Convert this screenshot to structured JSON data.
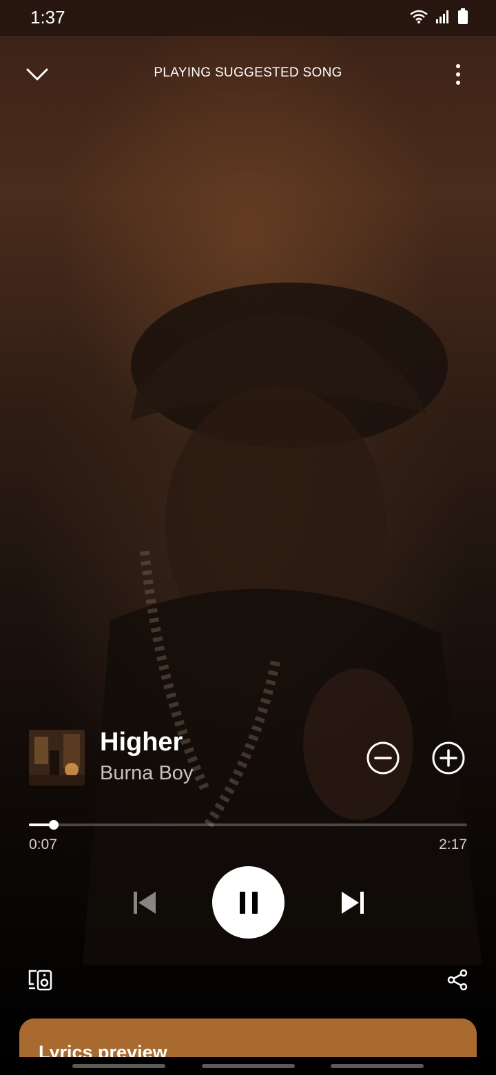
{
  "status_bar": {
    "time": "1:37"
  },
  "header": {
    "title": "PLAYING SUGGESTED SONG"
  },
  "track": {
    "title": "Higher",
    "artist": "Burna Boy"
  },
  "playback": {
    "elapsed": "0:07",
    "total": "2:17",
    "progress_fraction": 0.056,
    "state": "playing"
  },
  "lyrics": {
    "title": "Lyrics preview"
  },
  "colors": {
    "accent_lyrics": "#a86a2e",
    "background": "#0b0908"
  },
  "icons": {
    "collapse": "chevron-down-icon",
    "more": "more-vert-icon",
    "remove": "minus-circle-icon",
    "add": "plus-circle-icon",
    "previous": "skip-previous-icon",
    "pause": "pause-icon",
    "next": "skip-next-icon",
    "devices": "devices-icon",
    "share": "share-icon"
  }
}
